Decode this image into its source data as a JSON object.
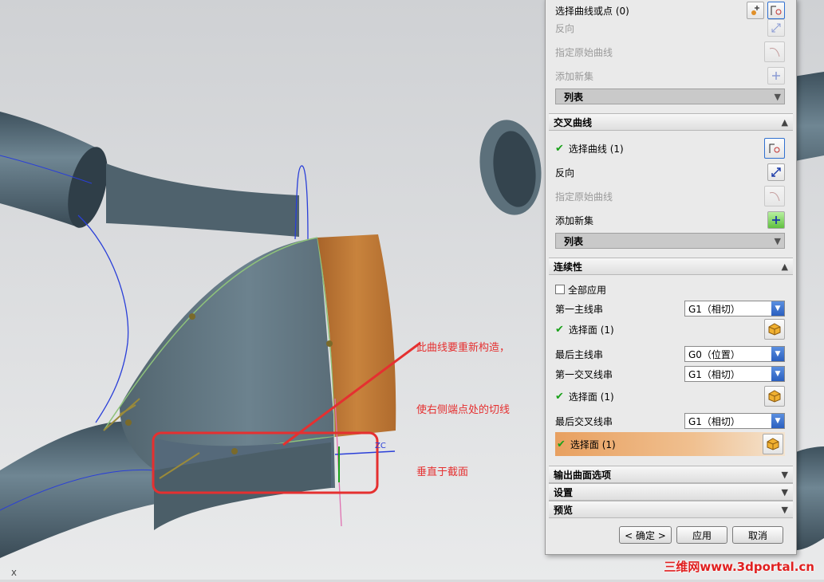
{
  "annotation": {
    "lines": [
      "此曲线要重新构造，",
      "使右侧端点处的切线",
      "垂直于截面"
    ]
  },
  "watermark": "三维网www.3dportal.cn",
  "viewport_axis_label": "X",
  "colors": {
    "tube": "#5f7480",
    "orange_face": "#c07a35",
    "annotation_red": "#e53030",
    "highlight_orange": "#e8a060",
    "check_green": "#1aa11a",
    "curve_blue": "#2a3fd8"
  },
  "dialog": {
    "top_group": {
      "select_curve_or_point": "选择曲线或点 (0)",
      "reverse": "反向",
      "specify_origin_curve": "指定原始曲线",
      "add_new_set": "添加新集",
      "list": "列表"
    },
    "cross_curves": {
      "title": "交叉曲线",
      "select_curve": "选择曲线 (1)",
      "reverse": "反向",
      "specify_origin_curve": "指定原始曲线",
      "add_new_set": "添加新集",
      "list": "列表"
    },
    "continuity": {
      "title": "连续性",
      "apply_all": "全部应用",
      "first_primary": {
        "label": "第一主线串",
        "value": "G1（相切）"
      },
      "first_primary_face": "选择面 (1)",
      "last_primary": {
        "label": "最后主线串",
        "value": "G0（位置）"
      },
      "first_cross": {
        "label": "第一交叉线串",
        "value": "G1（相切）"
      },
      "first_cross_face": "选择面 (1)",
      "last_cross": {
        "label": "最后交叉线串",
        "value": "G1（相切）"
      },
      "last_cross_face": "选择面 (1)"
    },
    "sections": {
      "output_surface": "输出曲面选项",
      "settings": "设置",
      "preview": "预览"
    },
    "buttons": {
      "ok": "< 确定 >",
      "apply": "应用",
      "cancel": "取消"
    }
  }
}
